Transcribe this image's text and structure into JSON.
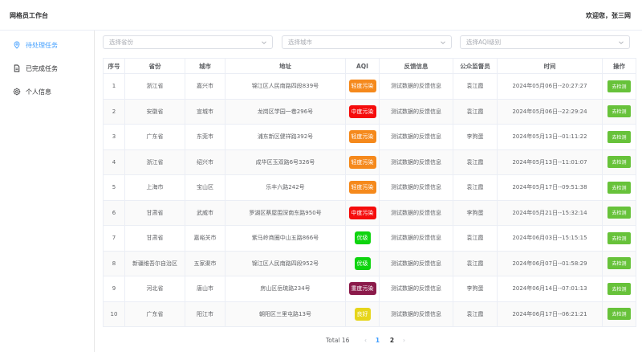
{
  "header": {
    "app_title": "网格员工作台",
    "welcome": "欢迎您，张三网"
  },
  "sidebar": {
    "items": [
      {
        "label": "待处理任务",
        "icon": "location-pin-icon",
        "active": true
      },
      {
        "label": "已完成任务",
        "icon": "document-icon",
        "active": false
      },
      {
        "label": "个人信息",
        "icon": "gear-icon",
        "active": false
      }
    ]
  },
  "filters": {
    "province_placeholder": "选择省份",
    "city_placeholder": "选择城市",
    "aqi_placeholder": "选择AQI级别"
  },
  "table": {
    "columns": [
      "序号",
      "省份",
      "城市",
      "地址",
      "AQI",
      "反馈信息",
      "公众监督员",
      "时间",
      "操作"
    ],
    "rows": [
      {
        "no": "1",
        "province": "浙江省",
        "city": "嘉兴市",
        "address": "锦江区人民南路四段839号",
        "aqi": "轻度污染",
        "aqi_color": "#f5891c",
        "feedback": "测试数据的反馈信息",
        "supervisor": "袁江霞",
        "time": "2024年05月06日--20:27:27",
        "action": "去检测"
      },
      {
        "no": "2",
        "province": "安徽省",
        "city": "宣城市",
        "address": "龙岗区学园一巷296号",
        "aqi": "中度污染",
        "aqi_color": "#f50c0c",
        "feedback": "测试数据的反馈信息",
        "supervisor": "袁江霞",
        "time": "2024年05月06日--22:29:24",
        "action": "去检测"
      },
      {
        "no": "3",
        "province": "广东省",
        "city": "东莞市",
        "address": "浦东新区健祥路392号",
        "aqi": "轻度污染",
        "aqi_color": "#f5891c",
        "feedback": "测试数据的反馈信息",
        "supervisor": "李狗蛋",
        "time": "2024年05月13日--01:11:22",
        "action": "去检测"
      },
      {
        "no": "4",
        "province": "浙江省",
        "city": "绍兴市",
        "address": "成华区玉双路6号326号",
        "aqi": "轻度污染",
        "aqi_color": "#f5891c",
        "feedback": "测试数据的反馈信息",
        "supervisor": "袁江霞",
        "time": "2024年05月13日--11:01:07",
        "action": "去检测"
      },
      {
        "no": "5",
        "province": "上海市",
        "city": "宝山区",
        "address": "乐丰六路242号",
        "aqi": "轻度污染",
        "aqi_color": "#f5891c",
        "feedback": "测试数据的反馈信息",
        "supervisor": "袁江霞",
        "time": "2024年05月17日--09:51:38",
        "action": "去检测"
      },
      {
        "no": "6",
        "province": "甘肃省",
        "city": "武威市",
        "address": "罗湖区蔡屋围深南东路950号",
        "aqi": "中度污染",
        "aqi_color": "#f50c0c",
        "feedback": "测试数据的反馈信息",
        "supervisor": "李狗蛋",
        "time": "2024年05月21日--15:32:14",
        "action": "去检测"
      },
      {
        "no": "7",
        "province": "甘肃省",
        "city": "嘉峪关市",
        "address": "紫马岭商圈中山五路866号",
        "aqi": "优级",
        "aqi_color": "#0ed40e",
        "feedback": "测试数据的反馈信息",
        "supervisor": "袁江霞",
        "time": "2024年06月03日--15:15:15",
        "action": "去检测"
      },
      {
        "no": "8",
        "province": "新疆维吾尔自治区",
        "city": "五家渠市",
        "address": "锦江区人民南路四段952号",
        "aqi": "优级",
        "aqi_color": "#0ed40e",
        "feedback": "测试数据的反馈信息",
        "supervisor": "袁江霞",
        "time": "2024年06月07日--01:58:29",
        "action": "去检测"
      },
      {
        "no": "9",
        "province": "河北省",
        "city": "唐山市",
        "address": "房山区岳琉路234号",
        "aqi": "重度污染",
        "aqi_color": "#8b1a4a",
        "feedback": "测试数据的反馈信息",
        "supervisor": "李狗蛋",
        "time": "2024年06月14日--07:01:13",
        "action": "去检测"
      },
      {
        "no": "10",
        "province": "广东省",
        "city": "阳江市",
        "address": "朝阳区三里屯路13号",
        "aqi": "良好",
        "aqi_color": "#e6d51a",
        "feedback": "测试数据的反馈信息",
        "supervisor": "袁江霞",
        "time": "2024年06月17日--06:21:21",
        "action": "去检测"
      }
    ]
  },
  "pagination": {
    "total_label": "Total 16",
    "pages": [
      "1",
      "2"
    ],
    "current_page": "1"
  }
}
